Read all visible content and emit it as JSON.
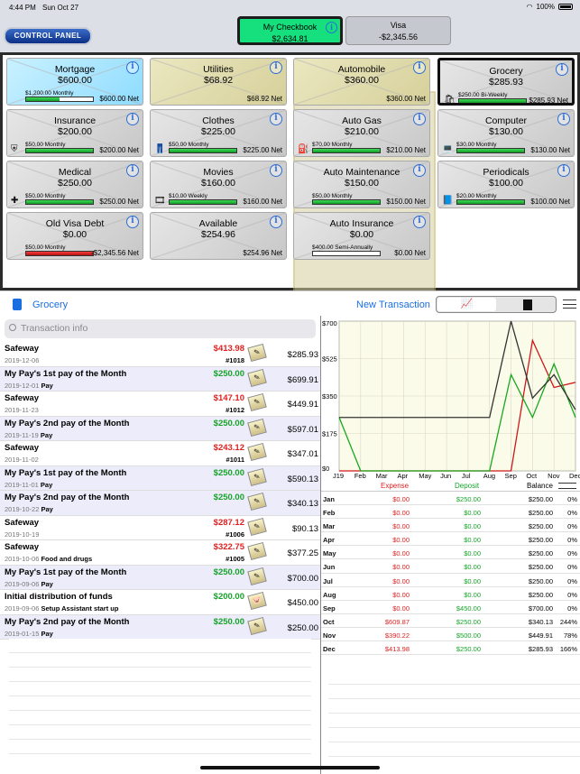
{
  "status": {
    "time": "4:44 PM",
    "date": "Sun Oct 27",
    "battery": "100%"
  },
  "control_panel": "CONTROL PANEL",
  "accounts": [
    {
      "name": "My Checkbook",
      "balance": "$2,634.81",
      "selected": true
    },
    {
      "name": "Visa",
      "balance": "-$2,345.56",
      "selected": false
    }
  ],
  "envelopes": [
    {
      "name": "Mortgage",
      "amount": "$600.00",
      "budget": "$1,200.00 Monthly",
      "net": "$600.00 Net",
      "fill": 0.5,
      "style": "blue",
      "icon": "",
      "bar": true
    },
    {
      "name": "Utilities",
      "amount": "$68.92",
      "budget": "",
      "net": "$68.92 Net",
      "fill": 0,
      "style": "tan",
      "icon": "",
      "bar": false
    },
    {
      "name": "Automobile",
      "amount": "$360.00",
      "budget": "",
      "net": "$360.00 Net",
      "fill": 0,
      "style": "tan",
      "icon": "",
      "bar": false
    },
    {
      "name": "Grocery",
      "amount": "$285.93",
      "budget": "$250.00 Bi-Weekly",
      "net": "$285.93 Net",
      "fill": 1,
      "style": "black",
      "icon": "bag-icon",
      "bar": true
    },
    {
      "name": "Insurance",
      "amount": "$200.00",
      "budget": "$50.00 Monthly",
      "net": "$200.00 Net",
      "fill": 1,
      "style": "gray",
      "icon": "shield-icon",
      "bar": true
    },
    {
      "name": "Clothes",
      "amount": "$225.00",
      "budget": "$50.00 Monthly",
      "net": "$225.00 Net",
      "fill": 1,
      "style": "gray",
      "icon": "jeans-icon",
      "bar": true
    },
    {
      "name": "Auto Gas",
      "amount": "$210.00",
      "budget": "$70.00 Monthly",
      "net": "$210.00 Net",
      "fill": 1,
      "style": "gray",
      "icon": "gas-pump-icon",
      "bar": true
    },
    {
      "name": "Computer",
      "amount": "$130.00",
      "budget": "$30.00 Monthly",
      "net": "$130.00 Net",
      "fill": 1,
      "style": "gray",
      "icon": "laptop-icon",
      "bar": true
    },
    {
      "name": "Medical",
      "amount": "$250.00",
      "budget": "$50.00 Monthly",
      "net": "$250.00 Net",
      "fill": 1,
      "style": "gray",
      "icon": "medical-cross-icon",
      "bar": true
    },
    {
      "name": "Movies",
      "amount": "$160.00",
      "budget": "$10.00 Weekly",
      "net": "$160.00 Net",
      "fill": 1,
      "style": "gray",
      "icon": "film-icon",
      "bar": true
    },
    {
      "name": "Auto Maintenance",
      "amount": "$150.00",
      "budget": "$50.00 Monthly",
      "net": "$150.00 Net",
      "fill": 1,
      "style": "gray",
      "icon": "",
      "bar": true
    },
    {
      "name": "Periodicals",
      "amount": "$100.00",
      "budget": "$20.00 Monthly",
      "net": "$100.00 Net",
      "fill": 1,
      "style": "gray",
      "icon": "book-icon",
      "bar": true
    },
    {
      "name": "Old Visa Debt",
      "amount": "$0.00",
      "budget": "$50.00 Monthly",
      "net": "-$2,345.56 Net",
      "fill": 1,
      "style": "gray",
      "icon": "",
      "bar": true,
      "red": true
    },
    {
      "name": "Available",
      "amount": "$254.96",
      "budget": "",
      "net": "$254.96 Net",
      "fill": 0,
      "style": "gray",
      "icon": "",
      "bar": false
    },
    {
      "name": "Auto Insurance",
      "amount": "$0.00",
      "budget": "$400.00 Semi-Annually",
      "net": "$0.00 Net",
      "fill": 0,
      "style": "gray",
      "icon": "",
      "bar": true
    }
  ],
  "subbar": {
    "category": "Grocery",
    "new_transaction": "New Transaction"
  },
  "search": {
    "placeholder": "Transaction info"
  },
  "transactions": [
    {
      "payee": "Safeway",
      "date": "2019-12-06",
      "memo": "",
      "amount": "$413.98",
      "type": "neg",
      "check": "#1018",
      "balance": "$285.93"
    },
    {
      "payee": "My Pay's 1st pay of the Month",
      "date": "2019-12-01",
      "memo": "Pay",
      "amount": "$250.00",
      "type": "pos",
      "check": "",
      "balance": "$699.91"
    },
    {
      "payee": "Safeway",
      "date": "2019-11-23",
      "memo": "",
      "amount": "$147.10",
      "type": "neg",
      "check": "#1012",
      "balance": "$449.91"
    },
    {
      "payee": "My Pay's 2nd pay of the Month",
      "date": "2019-11-19",
      "memo": "Pay",
      "amount": "$250.00",
      "type": "pos",
      "check": "",
      "balance": "$597.01"
    },
    {
      "payee": "Safeway",
      "date": "2019-11-02",
      "memo": "",
      "amount": "$243.12",
      "type": "neg",
      "check": "#1011",
      "balance": "$347.01"
    },
    {
      "payee": "My Pay's 1st pay of the Month",
      "date": "2019-11-01",
      "memo": "Pay",
      "amount": "$250.00",
      "type": "pos",
      "check": "",
      "balance": "$590.13"
    },
    {
      "payee": "My Pay's 2nd pay of the Month",
      "date": "2019-10-22",
      "memo": "Pay",
      "amount": "$250.00",
      "type": "pos",
      "check": "",
      "balance": "$340.13"
    },
    {
      "payee": "Safeway",
      "date": "2019-10-19",
      "memo": "",
      "amount": "$287.12",
      "type": "neg",
      "check": "#1006",
      "balance": "$90.13"
    },
    {
      "payee": "Safeway",
      "date": "2019-10-06",
      "memo": "Food and drugs",
      "amount": "$322.75",
      "type": "neg",
      "check": "#1005",
      "balance": "$377.25"
    },
    {
      "payee": "My Pay's 1st pay of the Month",
      "date": "2019-09-06",
      "memo": "Pay",
      "amount": "$250.00",
      "type": "pos",
      "check": "",
      "balance": "$700.00"
    },
    {
      "payee": "Initial distribution of funds",
      "date": "2019-09-06",
      "memo": "Setup Assistant start up",
      "amount": "$200.00",
      "type": "pos",
      "check": "",
      "balance": "$450.00"
    },
    {
      "payee": "My Pay's 2nd pay of the Month",
      "date": "2019-01-15",
      "memo": "Pay",
      "amount": "$250.00",
      "type": "pos",
      "check": "",
      "balance": "$250.00"
    }
  ],
  "chart_data": {
    "type": "line",
    "categories": [
      "J19",
      "Feb",
      "Mar",
      "Apr",
      "May",
      "Jun",
      "Jul",
      "Aug",
      "Sep",
      "Oct",
      "Nov",
      "Dec"
    ],
    "yticks": [
      "$0",
      "$175",
      "$350",
      "$525",
      "$700"
    ],
    "ylim": [
      0,
      700
    ],
    "series": [
      {
        "values": [
          0,
          0,
          0,
          0,
          0,
          0,
          0,
          0,
          0,
          609.87,
          390.22,
          413.98
        ],
        "color": "#d01818"
      },
      {
        "values": [
          250,
          0,
          0,
          0,
          0,
          0,
          0,
          0,
          450,
          250,
          500,
          250
        ],
        "color": "#18a820"
      },
      {
        "values": [
          250,
          250,
          250,
          250,
          250,
          250,
          250,
          250,
          700,
          340.13,
          449.91,
          285.93
        ],
        "color": "#333333"
      }
    ]
  },
  "summary": {
    "headers": {
      "expense": "Expense",
      "deposit": "Deposit",
      "balance": "Balance"
    },
    "rows": [
      {
        "m": "Jan",
        "e": "$0.00",
        "d": "$250.00",
        "b": "$250.00",
        "p": "0%"
      },
      {
        "m": "Feb",
        "e": "$0.00",
        "d": "$0.00",
        "b": "$250.00",
        "p": "0%"
      },
      {
        "m": "Mar",
        "e": "$0.00",
        "d": "$0.00",
        "b": "$250.00",
        "p": "0%"
      },
      {
        "m": "Apr",
        "e": "$0.00",
        "d": "$0.00",
        "b": "$250.00",
        "p": "0%"
      },
      {
        "m": "May",
        "e": "$0.00",
        "d": "$0.00",
        "b": "$250.00",
        "p": "0%"
      },
      {
        "m": "Jun",
        "e": "$0.00",
        "d": "$0.00",
        "b": "$250.00",
        "p": "0%"
      },
      {
        "m": "Jul",
        "e": "$0.00",
        "d": "$0.00",
        "b": "$250.00",
        "p": "0%"
      },
      {
        "m": "Aug",
        "e": "$0.00",
        "d": "$0.00",
        "b": "$250.00",
        "p": "0%"
      },
      {
        "m": "Sep",
        "e": "$0.00",
        "d": "$450.00",
        "b": "$700.00",
        "p": "0%"
      },
      {
        "m": "Oct",
        "e": "$609.87",
        "d": "$250.00",
        "b": "$340.13",
        "p": "244%"
      },
      {
        "m": "Nov",
        "e": "$390.22",
        "d": "$500.00",
        "b": "$449.91",
        "p": "78%"
      },
      {
        "m": "Dec",
        "e": "$413.98",
        "d": "$250.00",
        "b": "$285.93",
        "p": "166%"
      }
    ]
  },
  "colors": {
    "accent": "#1b6ee0",
    "expense": "#e02020",
    "deposit": "#17a32a",
    "selected_account": "#16e07e"
  }
}
